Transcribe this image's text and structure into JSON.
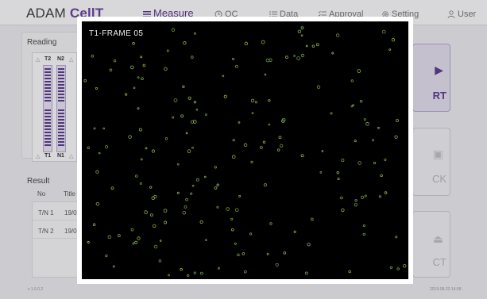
{
  "app": {
    "brand_prefix": "ADAM ",
    "brand_accent": "CellT",
    "accent_color": "#5a3290"
  },
  "nav": [
    {
      "label": "Measure",
      "icon": "menu-icon",
      "active": true
    },
    {
      "label": "QC",
      "icon": "clock-icon",
      "active": false
    },
    {
      "label": "Data",
      "icon": "list-icon",
      "active": false
    },
    {
      "label": "Approval",
      "icon": "checklist-icon",
      "active": false
    },
    {
      "label": "Setting",
      "icon": "gear-icon",
      "active": false
    },
    {
      "label": "User",
      "icon": "user-icon",
      "active": false
    }
  ],
  "reading": {
    "title": "Reading",
    "strip_labels": {
      "top_left": "T2",
      "top_right": "N2",
      "bottom_left": "T1",
      "bottom_right": "N1"
    }
  },
  "result": {
    "title": "Result",
    "columns": [
      "No",
      "Title"
    ],
    "rows": [
      {
        "no": "T/N 1",
        "title": "19/0"
      },
      {
        "no": "T/N 2",
        "title": "19/0"
      }
    ]
  },
  "buttons": {
    "start": "RT",
    "lock": "CK",
    "eject": "CT"
  },
  "footer": {
    "version": "v 1.0.0.2",
    "datetime": "2019-08-23 14:58"
  },
  "frame": {
    "label": "T1-FRAME  05"
  }
}
